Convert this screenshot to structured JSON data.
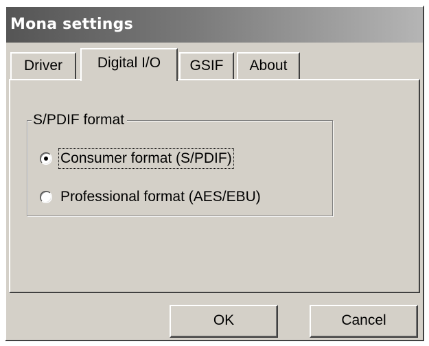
{
  "window": {
    "title": "Mona settings"
  },
  "tabs": [
    {
      "label": "Driver",
      "active": false
    },
    {
      "label": "Digital I/O",
      "active": true
    },
    {
      "label": "GSIF",
      "active": false
    },
    {
      "label": "About",
      "active": false
    }
  ],
  "spdif_group": {
    "legend": "S/PDIF format",
    "options": [
      {
        "label": "Consumer format (S/PDIF)",
        "selected": true
      },
      {
        "label": "Professional format (AES/EBU)",
        "selected": false
      }
    ]
  },
  "buttons": {
    "ok_label": "OK",
    "cancel_label": "Cancel"
  }
}
